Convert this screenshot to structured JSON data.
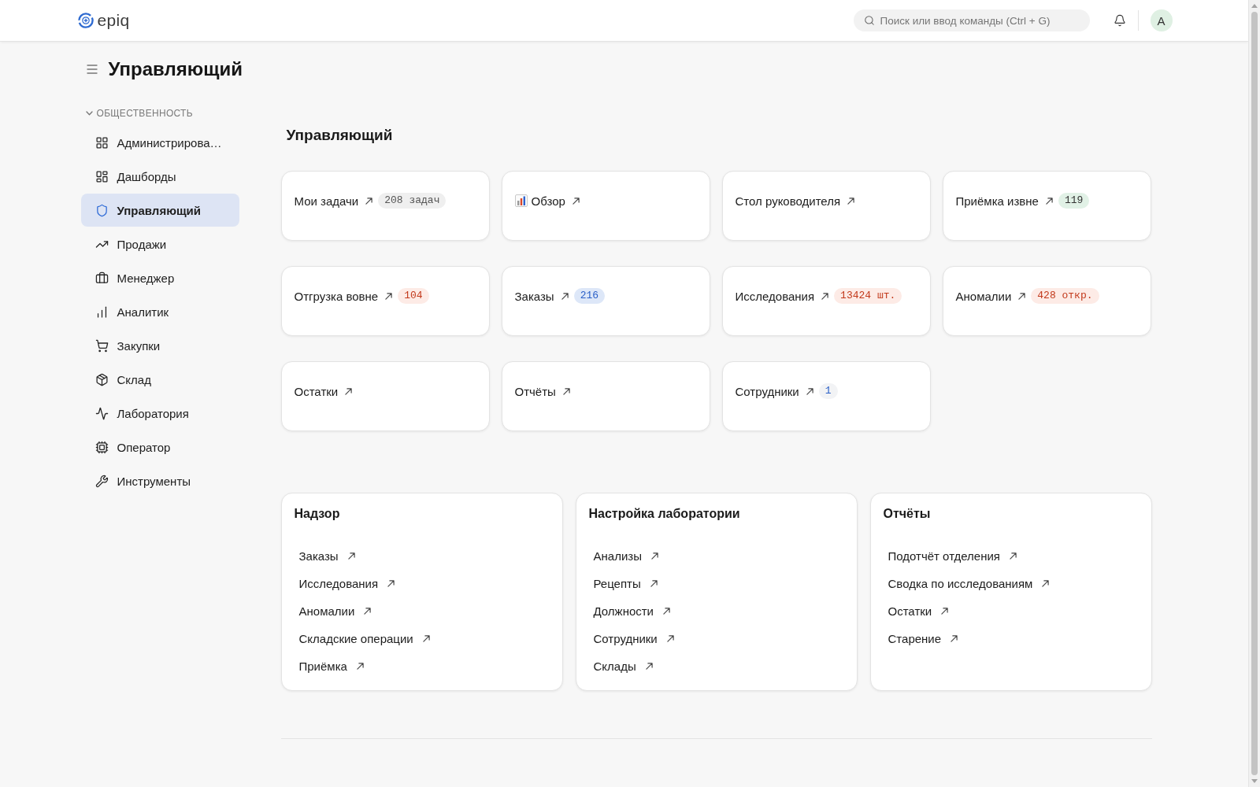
{
  "topbar": {
    "logo": "epiq",
    "search": {
      "placeholder": "Поиск или ввод команды (Ctrl + G)"
    },
    "avatar": "A"
  },
  "page_title": "Управляющий",
  "sidebar": {
    "section": {
      "label": "ОБЩЕСТВЕННОСТЬ",
      "expanded": true
    },
    "items": [
      {
        "label": "Администрирова…",
        "selected": false
      },
      {
        "label": "Дашборды",
        "selected": false
      },
      {
        "label": "Управляющий",
        "selected": true
      },
      {
        "label": "Продажи",
        "selected": false
      },
      {
        "label": "Менеджер",
        "selected": false
      },
      {
        "label": "Аналитик",
        "selected": false
      },
      {
        "label": "Закупки",
        "selected": false
      },
      {
        "label": "Склад",
        "selected": false
      },
      {
        "label": "Лаборатория",
        "selected": false
      },
      {
        "label": "Оператор",
        "selected": false
      },
      {
        "label": "Инструменты",
        "selected": false
      }
    ]
  },
  "main": {
    "heading": "Управляющий",
    "shortcuts": [
      {
        "label": "Мои задачи",
        "badge": {
          "text": "208 задач",
          "kind": "neutral"
        }
      },
      {
        "label": "Обзор",
        "icon": true
      },
      {
        "label": "Стол руководителя"
      },
      {
        "label": "Приёмка извне",
        "badge": {
          "text": "119",
          "kind": "success"
        }
      },
      {
        "label": "Отгрузка вовне",
        "badge": {
          "text": "104",
          "kind": "danger"
        }
      },
      {
        "label": "Заказы",
        "badge": {
          "text": "216",
          "kind": "info"
        }
      },
      {
        "label": "Исследования",
        "badge": {
          "text": "13424 шт.",
          "kind": "danger"
        }
      },
      {
        "label": "Аномалии",
        "badge": {
          "text": "428 откр.",
          "kind": "danger"
        }
      },
      {
        "label": "Остатки"
      },
      {
        "label": "Отчёты"
      },
      {
        "label": "Сотрудники",
        "badge": {
          "text": "1",
          "kind": "subtle"
        }
      }
    ],
    "panels": [
      {
        "title": "Надзор",
        "links": [
          "Заказы",
          "Исследования",
          "Аномалии",
          "Складские операции",
          "Приёмка"
        ]
      },
      {
        "title": "Настройка лаборатории",
        "links": [
          "Анализы",
          "Рецепты",
          "Должности",
          "Сотрудники",
          "Склады"
        ]
      },
      {
        "title": "Отчёты",
        "links": [
          "Подотчёт отделения",
          "Сводка по исследованиям",
          "Остатки",
          "Старение"
        ]
      }
    ]
  }
}
